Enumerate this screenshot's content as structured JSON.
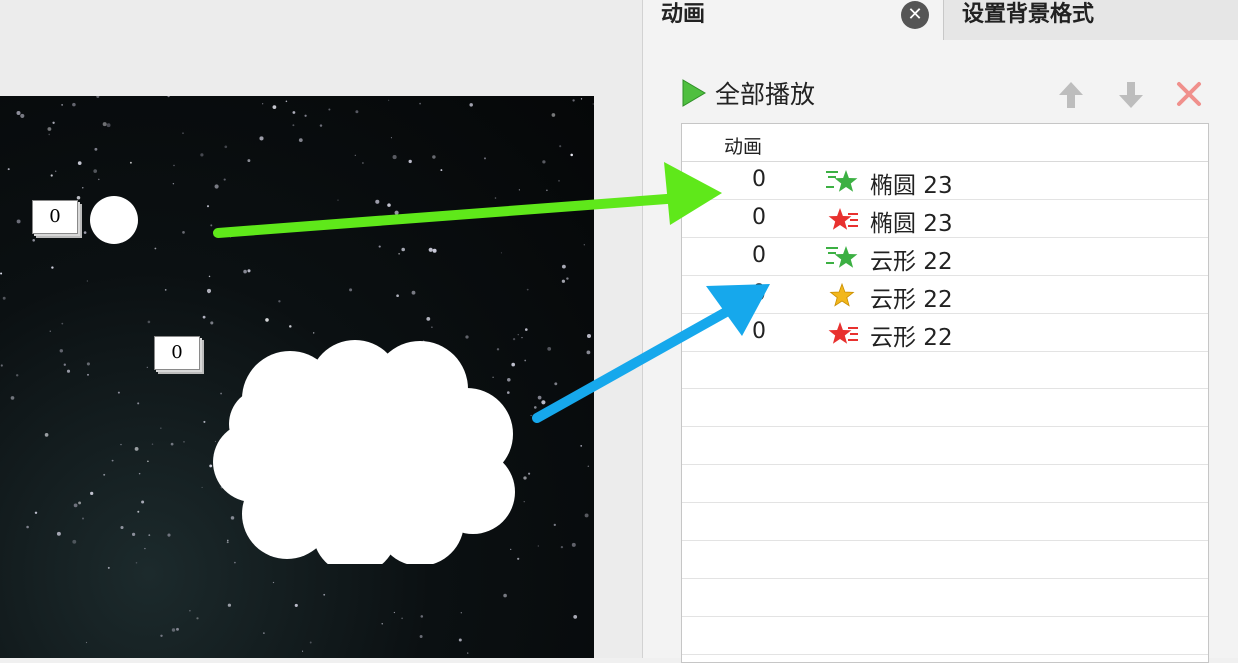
{
  "pane": {
    "title": "动画",
    "close_glyph": "✕",
    "other_tab": "设置背景格式",
    "play_all_label": "全部播放",
    "toolbar_icons": [
      "arrow-up-icon",
      "arrow-down-icon",
      "delete-x-icon"
    ],
    "list_header": "动画",
    "rows": [
      {
        "order": "0",
        "name": "椭圆 23",
        "effect": "entrance",
        "icon": "entrance-star-icon",
        "color": "#3cb043"
      },
      {
        "order": "0",
        "name": "椭圆 23",
        "effect": "exit",
        "icon": "exit-star-icon",
        "color": "#e8312f"
      },
      {
        "order": "0",
        "name": "云形 22",
        "effect": "entrance",
        "icon": "entrance-star-icon",
        "color": "#3cb043"
      },
      {
        "order": "0",
        "name": "云形 22",
        "effect": "emphasis",
        "icon": "emphasis-star-icon",
        "color": "#f2b71c"
      },
      {
        "order": "0",
        "name": "云形 22",
        "effect": "exit",
        "icon": "exit-star-icon",
        "color": "#e8312f"
      }
    ]
  },
  "slide": {
    "circle_tag": "0",
    "cloud_tag": "0",
    "background": "starry-night"
  },
  "annotations": {
    "green_arrow_color": "#5fe81a",
    "blue_arrow_color": "#16a8ec"
  }
}
